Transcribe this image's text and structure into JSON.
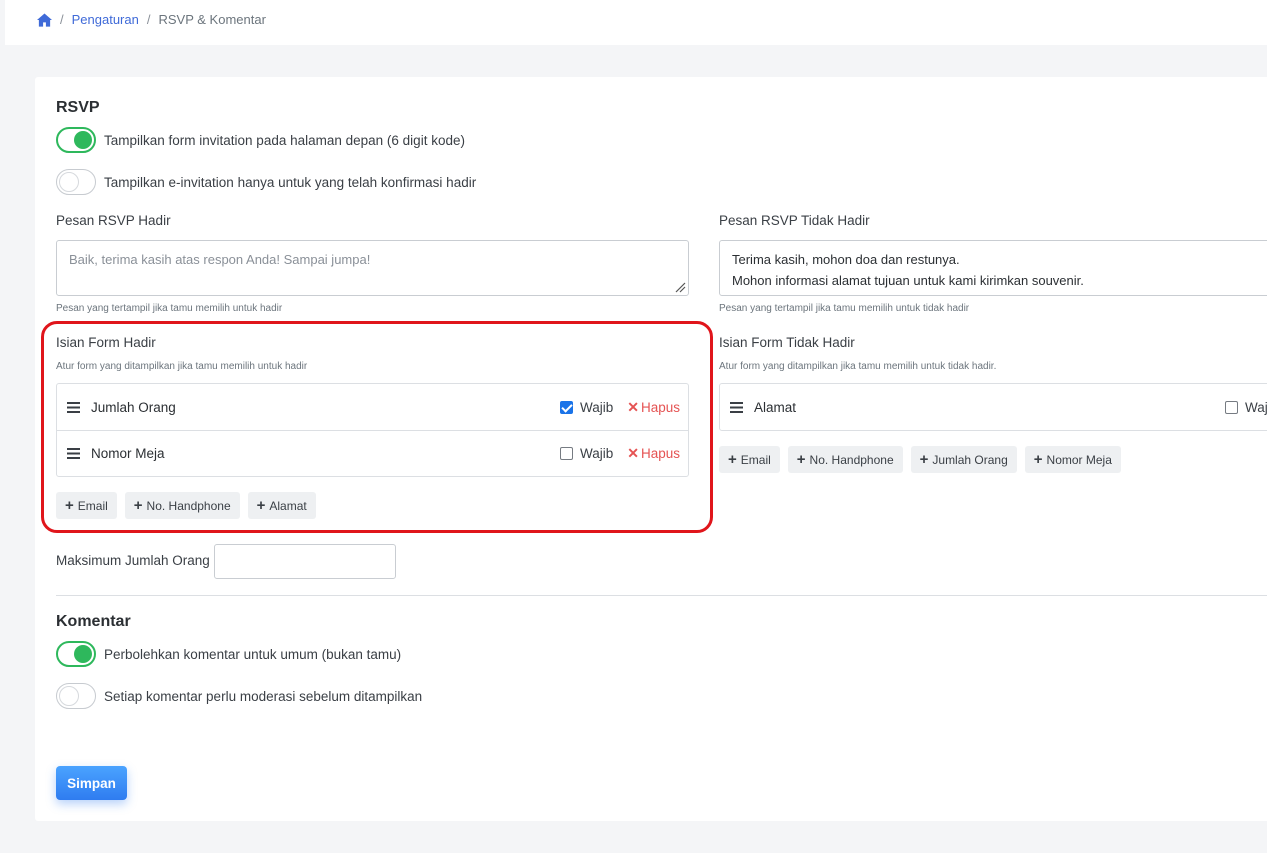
{
  "breadcrumb": {
    "home_icon": "home-icon",
    "items": [
      "Pengaturan",
      "RSVP & Komentar"
    ]
  },
  "rsvp": {
    "title": "RSVP",
    "toggle_front_form": {
      "label": "Tampilkan form invitation pada halaman depan (6 digit kode)",
      "on": true
    },
    "toggle_confirmed_only": {
      "label": "Tampilkan e-invitation hanya untuk yang telah konfirmasi hadir",
      "on": false
    },
    "msg_attend": {
      "label": "Pesan RSVP Hadir",
      "placeholder": "Baik, terima kasih atas respon Anda! Sampai jumpa!",
      "help": "Pesan yang tertampil jika tamu memilih untuk hadir"
    },
    "msg_not_attend": {
      "label": "Pesan RSVP Tidak Hadir",
      "line1": "Terima kasih, mohon doa dan restunya.",
      "line2": "Mohon informasi alamat tujuan untuk kami kirimkan souvenir.",
      "help": "Pesan yang tertampil jika tamu memilih untuk tidak hadir"
    },
    "form_attend": {
      "label": "Isian Form Hadir",
      "help": "Atur form yang ditampilkan jika tamu memilih untuk hadir",
      "fields": [
        {
          "name": "Jumlah Orang",
          "required_label": "Wajib",
          "required": true,
          "remove_label": "Hapus"
        },
        {
          "name": "Nomor Meja",
          "required_label": "Wajib",
          "required": false,
          "remove_label": "Hapus"
        }
      ],
      "add_buttons": [
        "Email",
        "No. Handphone",
        "Alamat"
      ]
    },
    "form_not_attend": {
      "label": "Isian Form Tidak Hadir",
      "help": "Atur form yang ditampilkan jika tamu memilih untuk tidak hadir.",
      "fields": [
        {
          "name": "Alamat",
          "required_label": "Waj",
          "required": false
        }
      ],
      "add_buttons": [
        "Email",
        "No. Handphone",
        "Jumlah Orang",
        "Nomor Meja"
      ]
    },
    "max_people": {
      "label": "Maksimum Jumlah Orang",
      "value": ""
    }
  },
  "comments": {
    "title": "Komentar",
    "toggle_public": {
      "label": "Perbolehkan komentar untuk umum (bukan tamu)",
      "on": true
    },
    "toggle_moderation": {
      "label": "Setiap komentar perlu moderasi sebelum ditampilkan",
      "on": false
    }
  },
  "save_label": "Simpan",
  "colors": {
    "primary": "#3f6ad8",
    "success": "#2eb85c",
    "danger": "#e55353",
    "highlight": "#e0151b"
  }
}
